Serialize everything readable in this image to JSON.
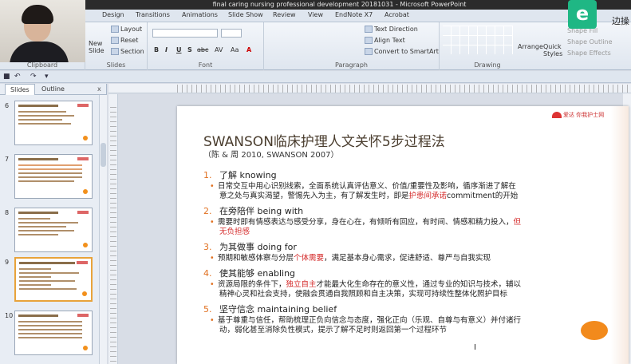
{
  "window": {
    "title": "final caring nursing professional development 20181031 - Microsoft PowerPoint"
  },
  "ribbon_tabs": [
    "Design",
    "Transitions",
    "Animations",
    "Slide Show",
    "Review",
    "View",
    "EndNote X7",
    "Acrobat"
  ],
  "ribbon": {
    "clipboard": {
      "label": "Clipboard"
    },
    "slides": {
      "new_slide": "New Slide",
      "layout": "Layout",
      "reset": "Reset",
      "section": "Section",
      "label": "Slides"
    },
    "font": {
      "label": "Font",
      "buttons": [
        "B",
        "I",
        "U",
        "S",
        "abc",
        "AV",
        "Aa",
        "A"
      ]
    },
    "paragraph": {
      "text_direction": "Text Direction",
      "align_text": "Align Text",
      "convert_smartart": "Convert to SmartArt",
      "label": "Paragraph"
    },
    "drawing": {
      "arrange": "Arrange",
      "quick_styles": "Quick Styles",
      "shape_fill": "Shape Fill",
      "shape_outline": "Shape Outline",
      "shape_effects": "Shape Effects",
      "label": "Drawing"
    }
  },
  "overlay": {
    "logo_letter": "e",
    "logo_text": "边操"
  },
  "panel": {
    "tabs": {
      "slides": "Slides",
      "outline": "Outline",
      "close": "x"
    },
    "thumbnails": [
      {
        "num": "6"
      },
      {
        "num": "7"
      },
      {
        "num": "8"
      },
      {
        "num": "9"
      },
      {
        "num": "10"
      }
    ]
  },
  "slide": {
    "logo_text": "爱达 你我护士网",
    "title": "SWANSON临床护理人文关怀5步过程法",
    "subtitle": "（陈 & 周 2010, SWANSON 2007）",
    "items": [
      {
        "num": "1.",
        "head": "了解 knowing",
        "b1": "日常交互中用心识别线索，全面系统认真评估意义、价值/重要性及影响，循序渐进了解在",
        "b2a": "意之处与真实渴望，警惕先入为主，有了解发生时，即是",
        "b2red": "护患间承诺",
        "b2b": "commitment的开始"
      },
      {
        "num": "2.",
        "head": "在旁陪伴 being with",
        "b1a": "需要时即有情感表达与感受分享，身在心在，有倾听有回应，有时间、情感和精力投入，",
        "b1red": "但",
        "b2red": "无负担感"
      },
      {
        "num": "3.",
        "head": "为其做事 doing for",
        "b1a": "预期和敏感体察与分层",
        "b1red": "个体需要",
        "b1b": "，满足基本身心需求，促进舒适、尊严与自我实现"
      },
      {
        "num": "4.",
        "head": "使其能够 enabling",
        "b1a": "资源局限的条件下，",
        "b1red": "独立自主",
        "b1b": "才能最大化生命存在的意义性，通过专业的知识与技术，辅以",
        "b2": "精神心灵和社会支持，使融会贯通自我照顾和自主决策，实现可持续性整体化照护目标"
      },
      {
        "num": "5.",
        "head": "坚守信念 maintaining belief",
        "b1": "基于尊重与信任，帮助梳理正负向信念与态度，强化正向（乐观、自尊与有意义）并付诸行",
        "b2": "动，弱化甚至消除负性模式，提示了解不足时则返回第一个过程环节"
      }
    ]
  },
  "colors": {
    "accent": "#e07020",
    "highlight": "#d42a2a",
    "logo": "#1fb784"
  }
}
